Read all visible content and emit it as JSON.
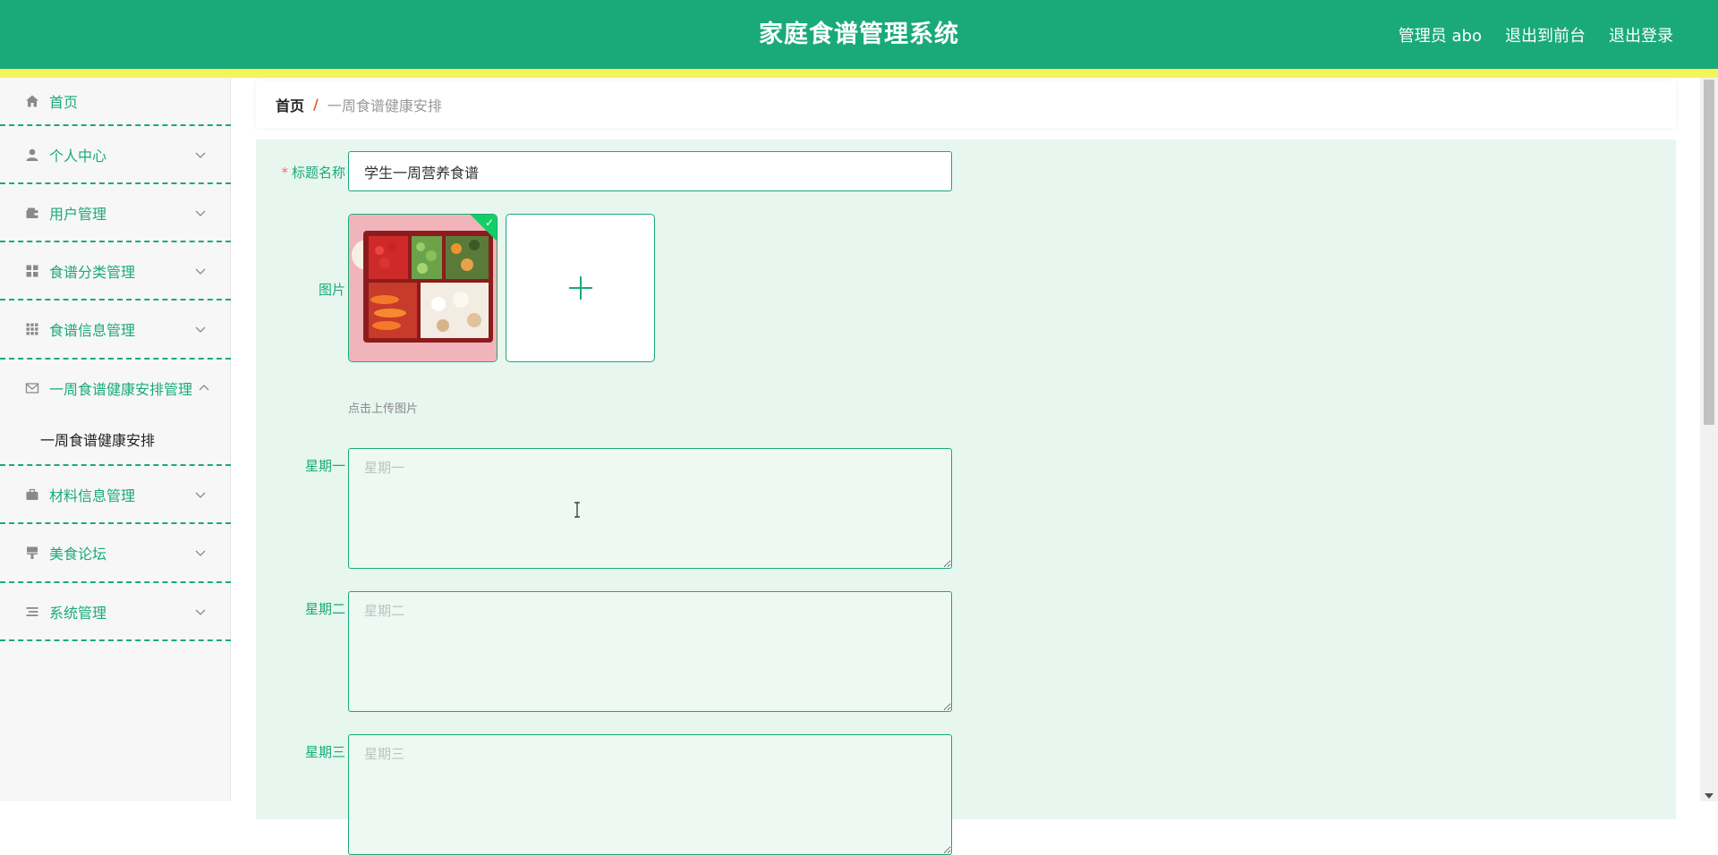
{
  "header": {
    "title": "家庭食谱管理系统",
    "user_label": "管理员 abo",
    "front_link": "退出到前台",
    "logout_link": "退出登录"
  },
  "colors": {
    "primary": "#1aaa79",
    "accent_bar": "#f5f55a",
    "form_bg": "#e7f6ef",
    "required": "#f56c6c"
  },
  "sidebar": {
    "items": [
      {
        "label": "首页",
        "icon": "home-icon",
        "expandable": false
      },
      {
        "label": "个人中心",
        "icon": "person-icon",
        "expandable": true
      },
      {
        "label": "用户管理",
        "icon": "wallet-icon",
        "expandable": true
      },
      {
        "label": "食谱分类管理",
        "icon": "grid-icon",
        "expandable": true
      },
      {
        "label": "食谱信息管理",
        "icon": "grid-dots-icon",
        "expandable": true
      },
      {
        "label": "一周食谱健康安排管理",
        "icon": "mail-icon",
        "expandable": true,
        "expanded": true,
        "children": [
          {
            "label": "一周食谱健康安排"
          }
        ]
      },
      {
        "label": "材料信息管理",
        "icon": "briefcase-icon",
        "expandable": true
      },
      {
        "label": "美食论坛",
        "icon": "brush-icon",
        "expandable": true
      },
      {
        "label": "系统管理",
        "icon": "list-icon",
        "expandable": true
      }
    ]
  },
  "breadcrumb": {
    "home": "首页",
    "separator": "/",
    "current": "一周食谱健康安排"
  },
  "form": {
    "title_label": "标题名称",
    "required_mark": "*",
    "title_value": "学生一周营养食谱",
    "image_label": "图片",
    "upload_hint": "点击上传图片",
    "upload_icon": "plus-icon",
    "monday_label": "星期一",
    "monday_placeholder": "星期一",
    "tuesday_label": "星期二",
    "tuesday_placeholder": "星期二",
    "wednesday_label": "星期三",
    "wednesday_placeholder": "星期三"
  }
}
